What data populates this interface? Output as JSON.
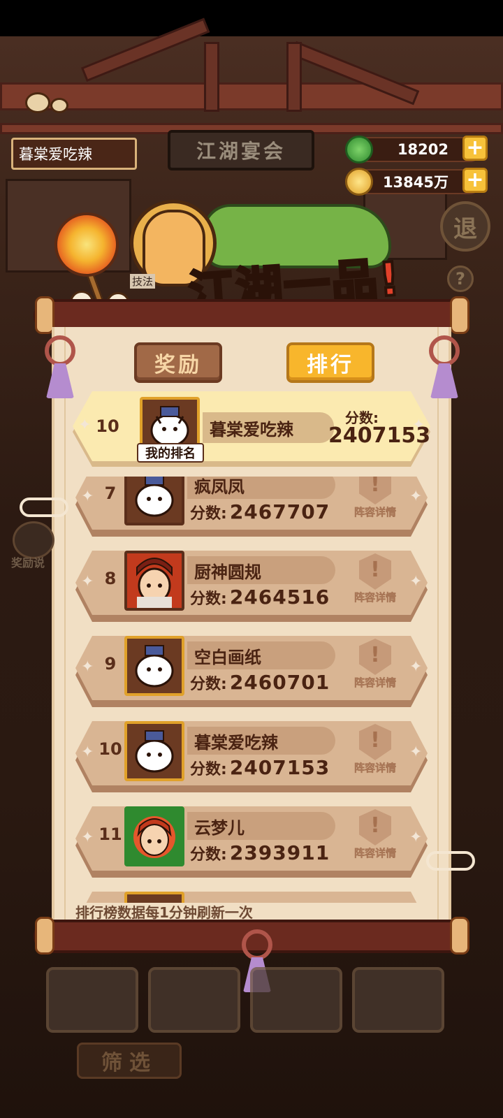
{
  "sign_text": "江湖宴会",
  "player_name": "暮棠爱吃辣",
  "currency": {
    "jade": "18202",
    "coins": "13845万",
    "plus": "+"
  },
  "exit_label": "退",
  "help_label": "?",
  "banner_title": "江湖一品!",
  "tabs": {
    "rewards": "奖励",
    "ranking": "排行"
  },
  "my_rank": {
    "rank": "10",
    "name": "暮棠爱吃辣",
    "badge": "我的排名",
    "score_label": "分数:",
    "score": "2407153"
  },
  "list_score_label": "分数:",
  "detail_label": "阵容详情",
  "rows": [
    {
      "rank": "7",
      "name": "疯凤凤",
      "score": "2467707"
    },
    {
      "rank": "8",
      "name": "厨神圆规",
      "score": "2464516"
    },
    {
      "rank": "9",
      "name": "空白画纸",
      "score": "2460701"
    },
    {
      "rank": "10",
      "name": "暮棠爱吃辣",
      "score": "2407153"
    },
    {
      "rank": "11",
      "name": "云梦儿",
      "score": "2393911"
    }
  ],
  "footer_note": "排行榜数据每1分钟刷新一次",
  "side_button_label": "奖励说",
  "side_text_left": "技法",
  "filter_label": "筛选",
  "colors": {
    "accent_orange": "#f8b62c",
    "banner_red": "#e2412a",
    "paper": "#f1dfc4",
    "row": "#d9b593",
    "my_row": "#fbeab0"
  }
}
